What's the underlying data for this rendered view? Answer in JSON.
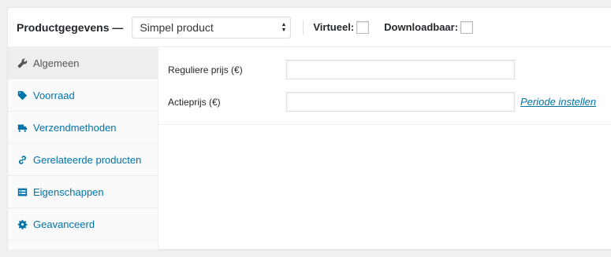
{
  "header": {
    "title": "Productgegevens —",
    "product_type": {
      "selected": "Simpel product"
    },
    "checkboxes": [
      {
        "label": "Virtueel:",
        "checked": false
      },
      {
        "label": "Downloadbaar:",
        "checked": false
      }
    ]
  },
  "tabs": [
    {
      "label": "Algemeen",
      "icon": "wrench-icon",
      "active": true
    },
    {
      "label": "Voorraad",
      "icon": "tag-icon",
      "active": false
    },
    {
      "label": "Verzendmethoden",
      "icon": "truck-icon",
      "active": false
    },
    {
      "label": "Gerelateerde producten",
      "icon": "link-icon",
      "active": false
    },
    {
      "label": "Eigenschappen",
      "icon": "list-icon",
      "active": false
    },
    {
      "label": "Geavanceerd",
      "icon": "gear-icon",
      "active": false
    }
  ],
  "general": {
    "regular_price_label": "Reguliere prijs (€)",
    "regular_price_value": "",
    "sale_price_label": "Actieprijs (€)",
    "sale_price_value": "",
    "schedule_link": "Periode instellen"
  },
  "colors": {
    "link": "#0073aa",
    "active_tab_bg": "#eeeeee",
    "tab_bg": "#fafafa"
  }
}
